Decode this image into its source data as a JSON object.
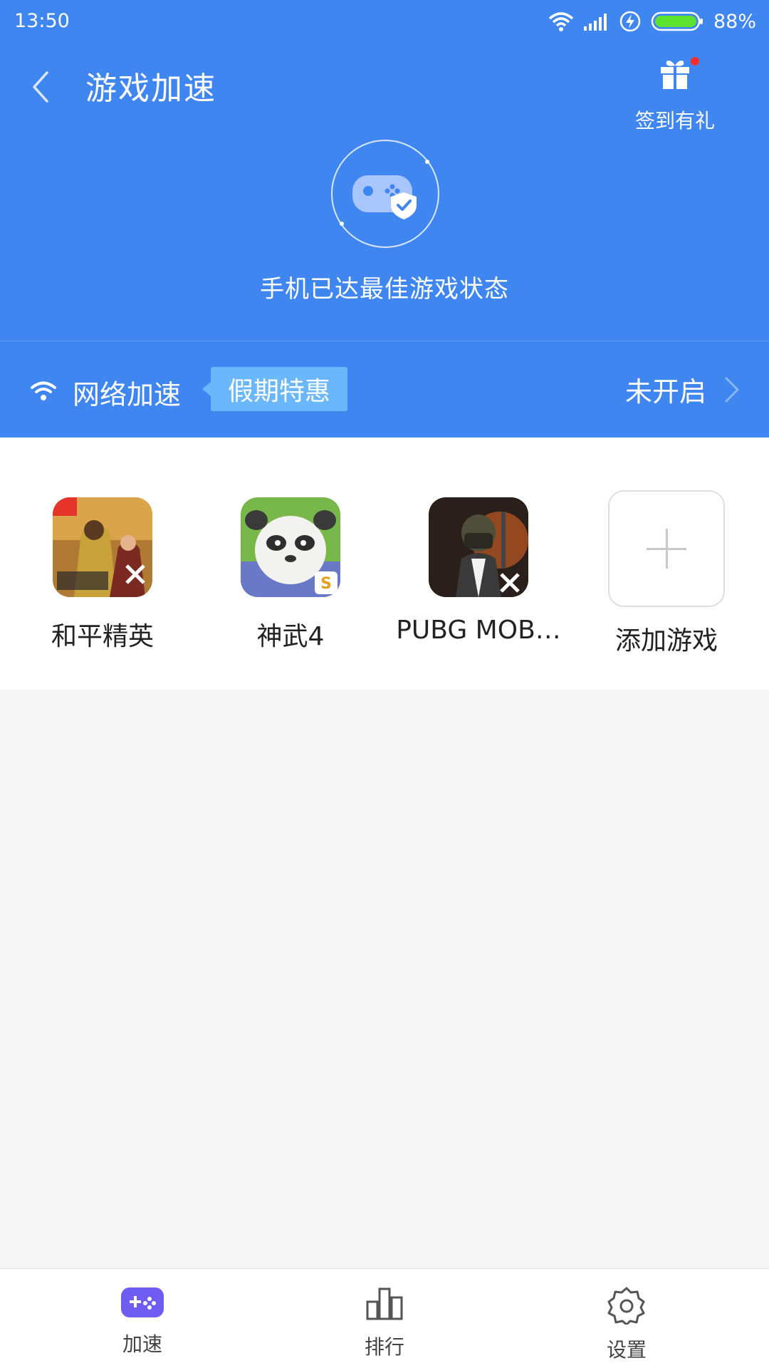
{
  "status_bar": {
    "time": "13:50",
    "battery_percent": "88%"
  },
  "header": {
    "title": "游戏加速",
    "gift_label": "签到有礼",
    "status_text": "手机已达最佳游戏状态"
  },
  "network_accel": {
    "label": "网络加速",
    "promo_badge": "假期特惠",
    "status": "未开启"
  },
  "games": [
    {
      "name": "和平精英",
      "icon": "game-icon-peace-elite"
    },
    {
      "name": "神武4",
      "icon": "game-icon-shenwu4"
    },
    {
      "name": "PUBG MOB…",
      "icon": "game-icon-pubg-mobile"
    }
  ],
  "add_game": {
    "label": "添加游戏"
  },
  "bottom_nav": {
    "items": [
      {
        "label": "加速",
        "icon": "gamepad-icon",
        "active": true
      },
      {
        "label": "排行",
        "icon": "bar-chart-icon",
        "active": false
      },
      {
        "label": "设置",
        "icon": "gear-icon",
        "active": false
      }
    ]
  },
  "colors": {
    "primary_blue": "#3f86f0",
    "promo_blue": "#6ab8fb",
    "active_nav": "#6f5cf2",
    "background": "#f6f6f6"
  }
}
